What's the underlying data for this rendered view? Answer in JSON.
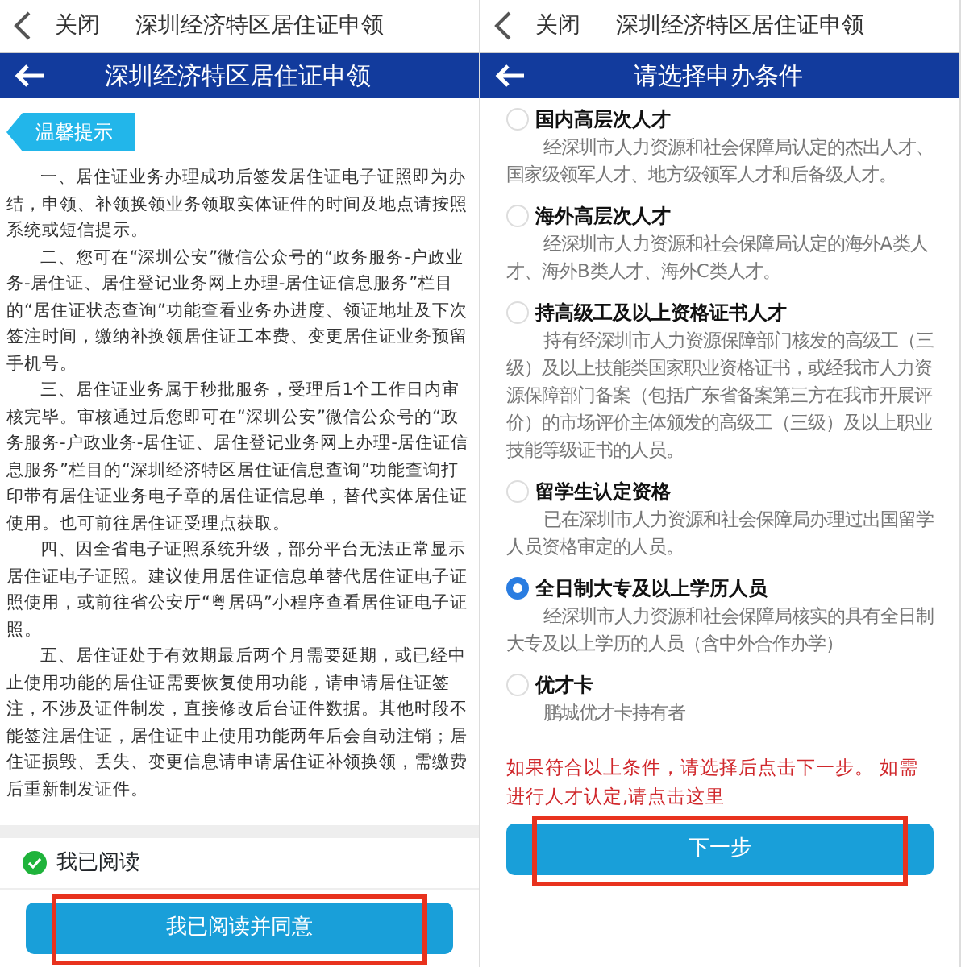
{
  "left_screen": {
    "top_bar": {
      "close_label": "关闭",
      "title": "深圳经济特区居住证申领"
    },
    "header": {
      "title": "深圳经济特区居住证申领"
    },
    "tip_tag": "温馨提示",
    "paragraphs": [
      "一、居住证业务办理成功后签发居住证电子证照即为办结，申领、补领换领业务领取实体证件的时间及地点请按照系统或短信提示。",
      "二、您可在“深圳公安”微信公众号的“政务服务-户政业务-居住证、居住登记业务网上办理-居住证信息服务”栏目的“居住证状态查询”功能查看业务办进度、领证地址及下次签注时间，缴纳补换领居住证工本费、变更居住证业务预留手机号。",
      "三、居住证业务属于秒批服务，受理后1个工作日内审核完毕。审核通过后您即可在“深圳公安”微信公众号的“政务服务-户政业务-居住证、居住登记业务网上办理-居住证信息服务”栏目的“深圳经济特区居住证信息查询”功能查询打印带有居住证业务电子章的居住证信息单，替代实体居住证使用。也可前往居住证受理点获取。",
      "四、因全省电子证照系统升级，部分平台无法正常显示居住证电子证照。建议使用居住证信息单替代居住证电子证照使用，或前往省公安厅“粤居码”小程序查看居住证电子证照。",
      "五、居住证处于有效期最后两个月需要延期，或已经中止使用功能的居住证需要恢复使用功能，请申请居住证签注，不涉及证件制发，直接修改后台证件数据。其他时段不能签注居住证，居住证中止使用功能两年后会自动注销；居住证损毁、丢失、变更信息请申请居住证补领换领，需缴费后重新制发证件。"
    ],
    "read_check": {
      "label": "我已阅读",
      "checked": true
    },
    "agree_button": {
      "label": "我已阅读并同意",
      "highlighted": true
    }
  },
  "right_screen": {
    "top_bar": {
      "close_label": "关闭",
      "title": "深圳经济特区居住证申领"
    },
    "header": {
      "title": "请选择申办条件"
    },
    "options": [
      {
        "title": "国内高层次人才",
        "description": "经深圳市人力资源和社会保障局认定的杰出人才、国家级领军人才、地方级领军人才和后备级人才。",
        "selected": false
      },
      {
        "title": "海外高层次人才",
        "description": "经深圳市人力资源和社会保障局认定的海外A类人才、海外B类人才、海外C类人才。",
        "selected": false
      },
      {
        "title": "持高级工及以上资格证书人才",
        "description": "持有经深圳市人力资源保障部门核发的高级工（三级）及以上技能类国家职业资格证书，或经我市人力资源保障部门备案（包括广东省备案第三方在我市开展评价）的市场评价主体颁发的高级工（三级）及以上职业技能等级证书的人员。",
        "selected": false
      },
      {
        "title": "留学生认定资格",
        "description": "已在深圳市人力资源和社会保障局办理过出国留学人员资格审定的人员。",
        "selected": false
      },
      {
        "title": "全日制大专及以上学历人员",
        "description": "经深圳市人力资源和社会保障局核实的具有全日制大专及以上学历的人员（含中外合作办学）",
        "selected": true
      },
      {
        "title": "优才卡",
        "description": "鹏城优才卡持有者",
        "selected": false
      }
    ],
    "notice": {
      "text": "如果符合以上条件，请选择后点击下一步。 如需进行人才认定,请点击",
      "link": "这里"
    },
    "next_button": {
      "label": "下一步",
      "highlighted": true
    }
  }
}
